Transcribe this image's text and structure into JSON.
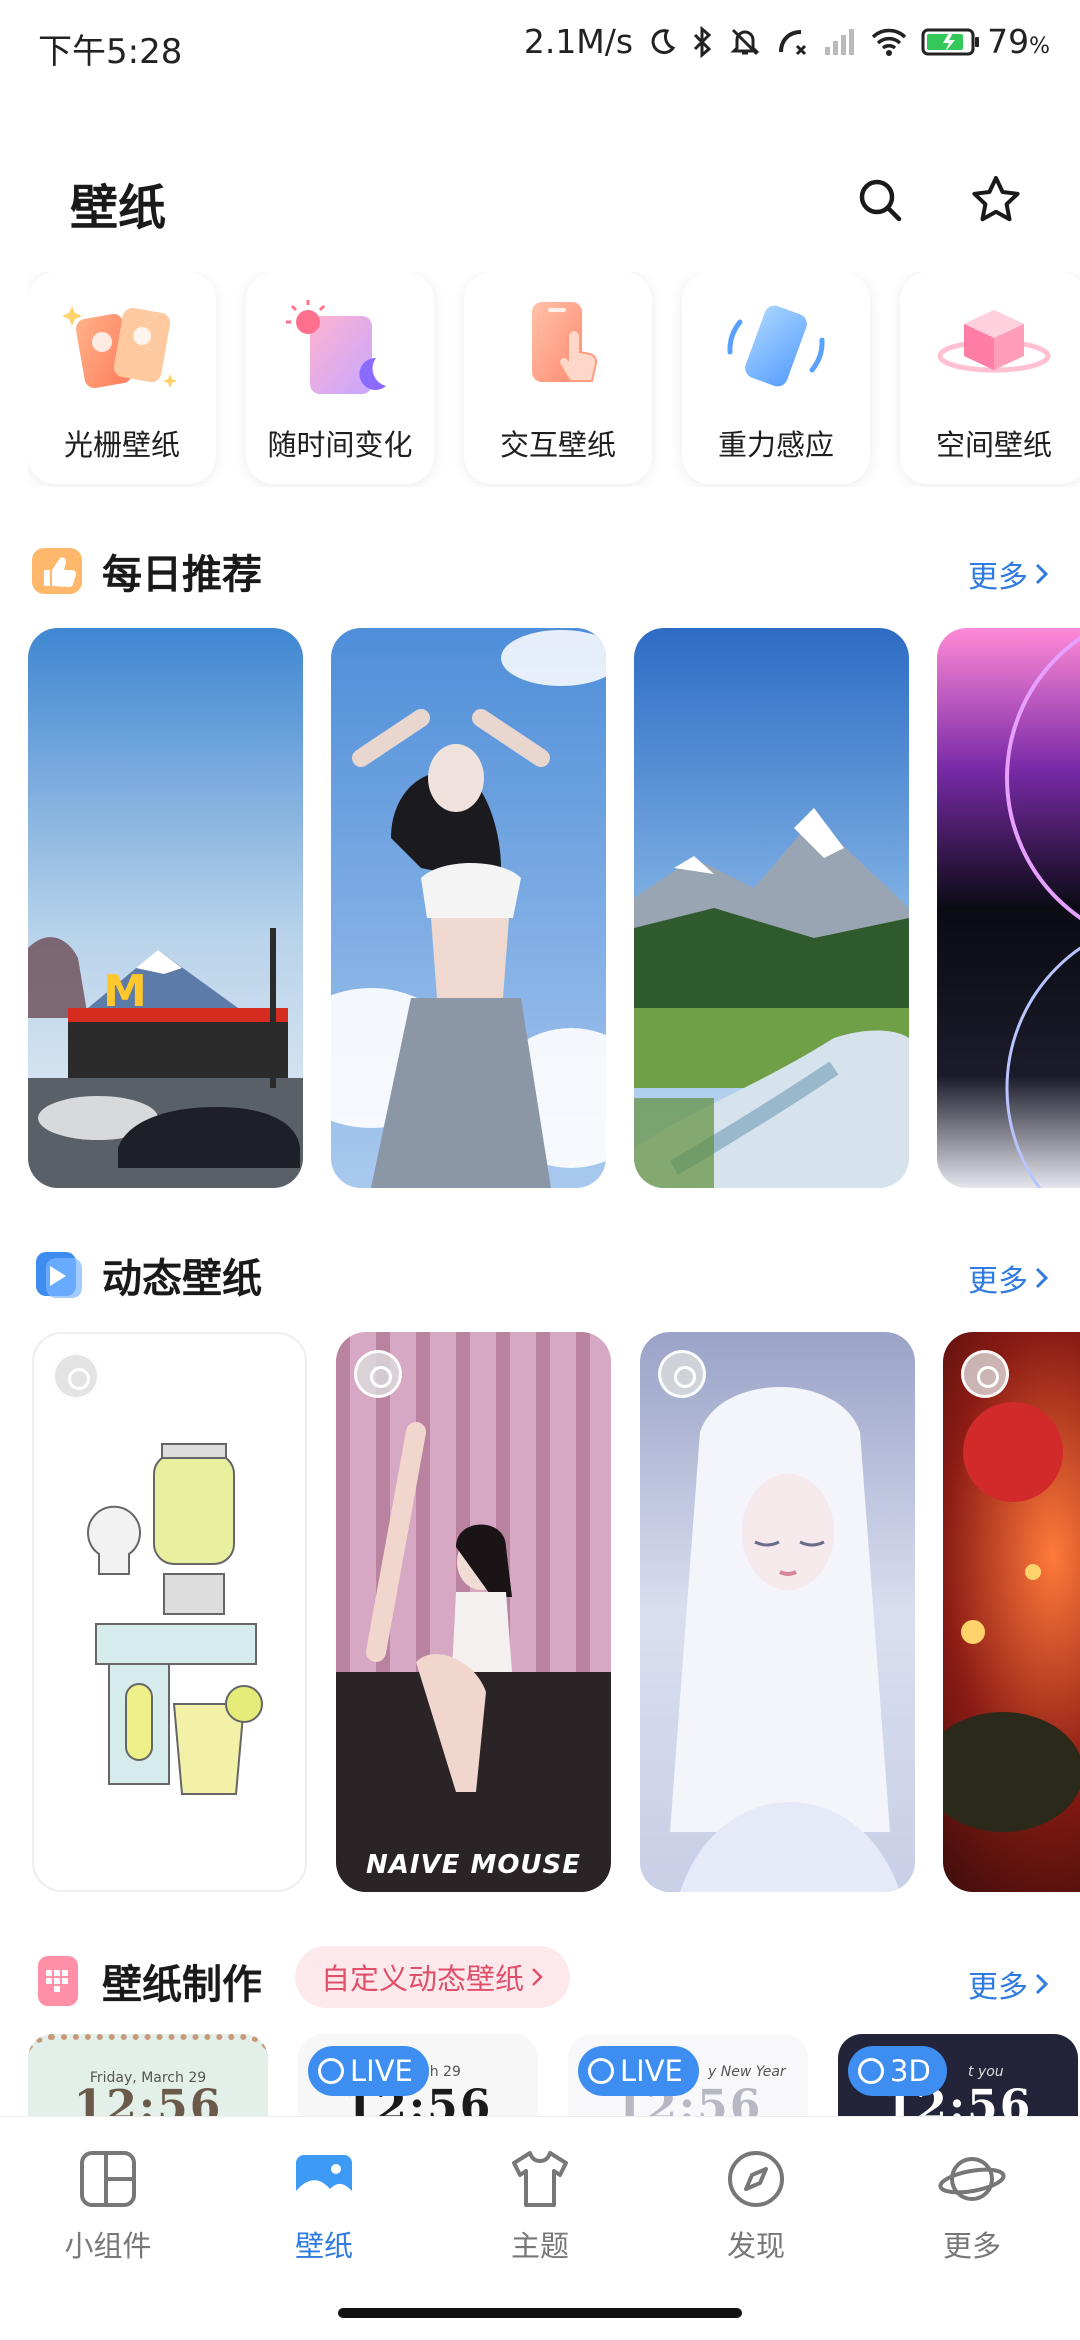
{
  "status_bar": {
    "time": "下午5:28",
    "speed": "2.1M/s",
    "battery": "79",
    "battery_unit": "%"
  },
  "header": {
    "title": "壁纸"
  },
  "categories": [
    {
      "label": "光栅壁纸",
      "icon": "lenticular-wallpaper-icon"
    },
    {
      "label": "随时间变化",
      "icon": "time-changing-icon"
    },
    {
      "label": "交互壁纸",
      "icon": "interactive-wallpaper-icon"
    },
    {
      "label": "重力感应",
      "icon": "gravity-sensor-icon"
    },
    {
      "label": "空间壁纸",
      "icon": "spatial-wallpaper-icon"
    }
  ],
  "daily": {
    "title": "每日推荐",
    "more": "更多"
  },
  "dynamic": {
    "title": "动态壁纸",
    "more": "更多"
  },
  "making": {
    "title": "壁纸制作",
    "tag": "自定义动态壁纸",
    "more": "更多",
    "cards": [
      {
        "date": "Friday, March 29",
        "clock": "12:56"
      },
      {
        "badge": "LIVE",
        "date": "arch 29",
        "clock": "12:56"
      },
      {
        "badge": "LIVE",
        "date": "y New Year",
        "clock": "12:56"
      },
      {
        "badge": "3D",
        "date": "t you",
        "clock": "12:56"
      }
    ]
  },
  "dynamic_cards": [
    {
      "overlay_text": ""
    },
    {
      "overlay_text": "NAIVE MOUSE"
    },
    {
      "overlay_text": ""
    },
    {
      "overlay_text": ""
    }
  ],
  "tabbar": [
    {
      "label": "小组件",
      "icon": "widget-icon"
    },
    {
      "label": "壁纸",
      "icon": "wallpaper-icon",
      "active": true
    },
    {
      "label": "主题",
      "icon": "tshirt-icon"
    },
    {
      "label": "发现",
      "icon": "compass-icon"
    },
    {
      "label": "更多",
      "icon": "planet-icon"
    }
  ],
  "colors": {
    "accent": "#2f7be0",
    "tag_bg": "#fde9ec",
    "tag_text": "#e0506b"
  }
}
